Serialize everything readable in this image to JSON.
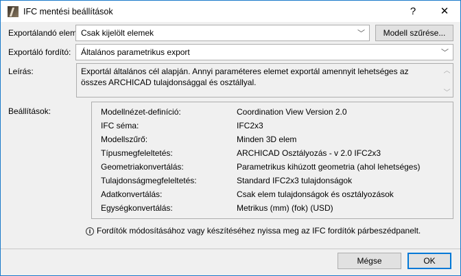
{
  "window": {
    "title": "IFC mentési beállítások",
    "help": "?",
    "close": "✕"
  },
  "export_elements": {
    "label": "Exportálandó elemek:",
    "value": "Csak kijelölt elemek",
    "filter_button": "Modell szűrése..."
  },
  "translator": {
    "label": "Exportáló fordító:",
    "value": "Általános parametrikus export"
  },
  "description": {
    "label": "Leírás:",
    "text": "Exportál általános cél alapján. Annyi paraméteres elemet exportál amennyit lehetséges az összes ARCHICAD tulajdonsággal és osztállyal."
  },
  "settings": {
    "label": "Beállítások:",
    "rows": [
      {
        "key": "Modellnézet-definíció:",
        "value": "Coordination View Version 2.0"
      },
      {
        "key": "IFC séma:",
        "value": "IFC2x3"
      },
      {
        "key": "Modellszűrő:",
        "value": "Minden 3D elem"
      },
      {
        "key": "Típusmegfeleltetés:",
        "value": "ARCHICAD Osztályozás - v 2.0 IFC2x3"
      },
      {
        "key": "Geometriakonvertálás:",
        "value": "Parametrikus kihúzott geometria (ahol lehetséges)"
      },
      {
        "key": "Tulajdonságmegfeleltetés:",
        "value": "Standard IFC2x3 tulajdonságok"
      },
      {
        "key": "Adatkonvertálás:",
        "value": "Csak elem tulajdonságok és osztályozások"
      },
      {
        "key": "Egységkonvertálás:",
        "value": "Metrikus (mm) (fok) (USD)"
      }
    ]
  },
  "info": "Fordítók módosításához vagy készítéséhez nyissa meg az IFC fordítók párbeszédpanelt.",
  "buttons": {
    "cancel": "Mégse",
    "ok": "OK"
  }
}
